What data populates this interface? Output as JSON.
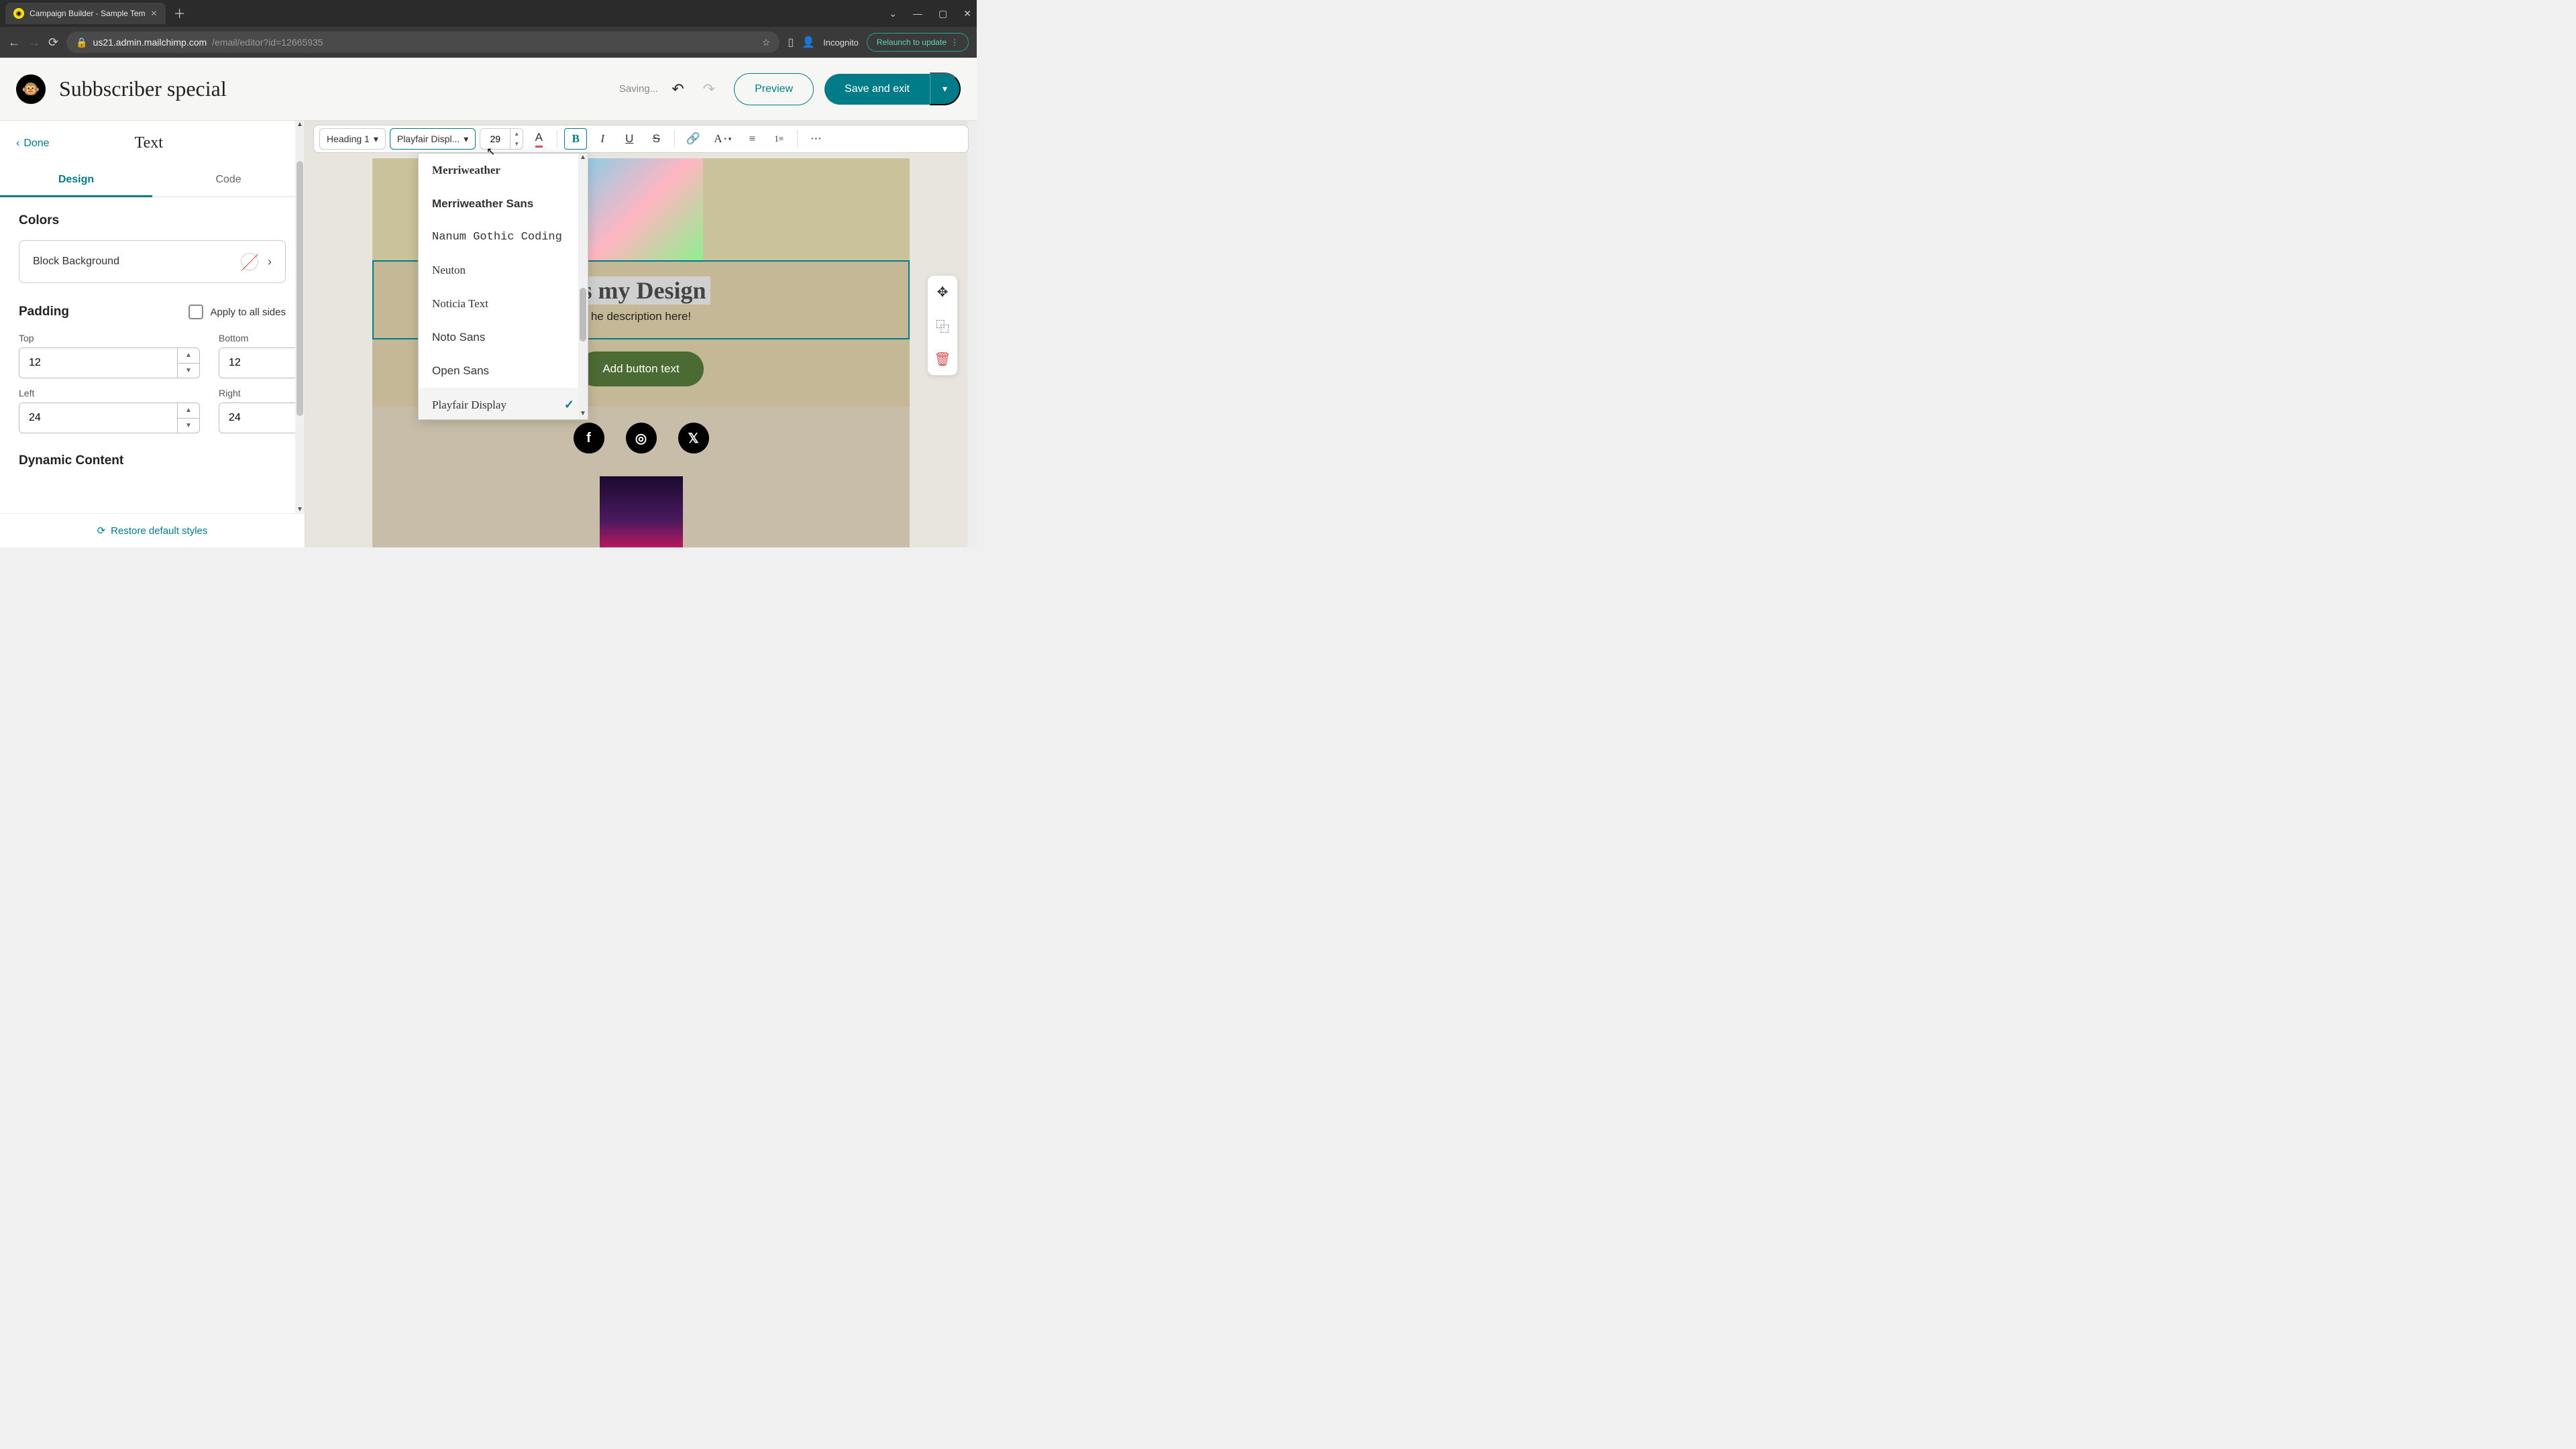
{
  "browser": {
    "tab_title": "Campaign Builder - Sample Tem",
    "url_host": "us21.admin.mailchimp.com",
    "url_path": "/email/editor?id=12665935",
    "incognito": "Incognito",
    "relaunch": "Relaunch to update"
  },
  "header": {
    "title": "Subbscriber special",
    "saving": "Saving...",
    "preview": "Preview",
    "save_exit": "Save and exit"
  },
  "sidebar": {
    "done": "Done",
    "title": "Text",
    "tab_design": "Design",
    "tab_code": "Code",
    "colors_title": "Colors",
    "block_bg": "Block Background",
    "padding_title": "Padding",
    "apply_all": "Apply to all sides",
    "pad": {
      "top_lbl": "Top",
      "top": "12",
      "bottom_lbl": "Bottom",
      "bottom": "12",
      "left_lbl": "Left",
      "left": "24",
      "right_lbl": "Right",
      "right": "24"
    },
    "dyn": "Dynamic Content",
    "restore": "Restore default styles"
  },
  "toolbar": {
    "heading": "Heading 1",
    "font": "Playfair Displ...",
    "size": "29"
  },
  "font_dropdown": {
    "items": [
      {
        "label": "Merriweather",
        "family": "Georgia, serif",
        "weight": "bold"
      },
      {
        "label": "Merriweather Sans",
        "family": "Arial, sans-serif",
        "weight": "bold"
      },
      {
        "label": "Nanum Gothic Coding",
        "family": "'Courier New', monospace",
        "weight": "normal"
      },
      {
        "label": "Neuton",
        "family": "Georgia, serif",
        "weight": "normal"
      },
      {
        "label": "Noticia Text",
        "family": "Georgia, serif",
        "weight": "normal"
      },
      {
        "label": "Noto Sans",
        "family": "Arial, sans-serif",
        "weight": "normal"
      },
      {
        "label": "Open Sans",
        "family": "Arial, sans-serif",
        "weight": "normal"
      },
      {
        "label": "Playfair Display",
        "family": "Georgia, serif",
        "weight": "normal",
        "selected": true
      }
    ]
  },
  "canvas": {
    "heading": "is my Design",
    "desc": "he description here!",
    "cta": "Add button text"
  }
}
